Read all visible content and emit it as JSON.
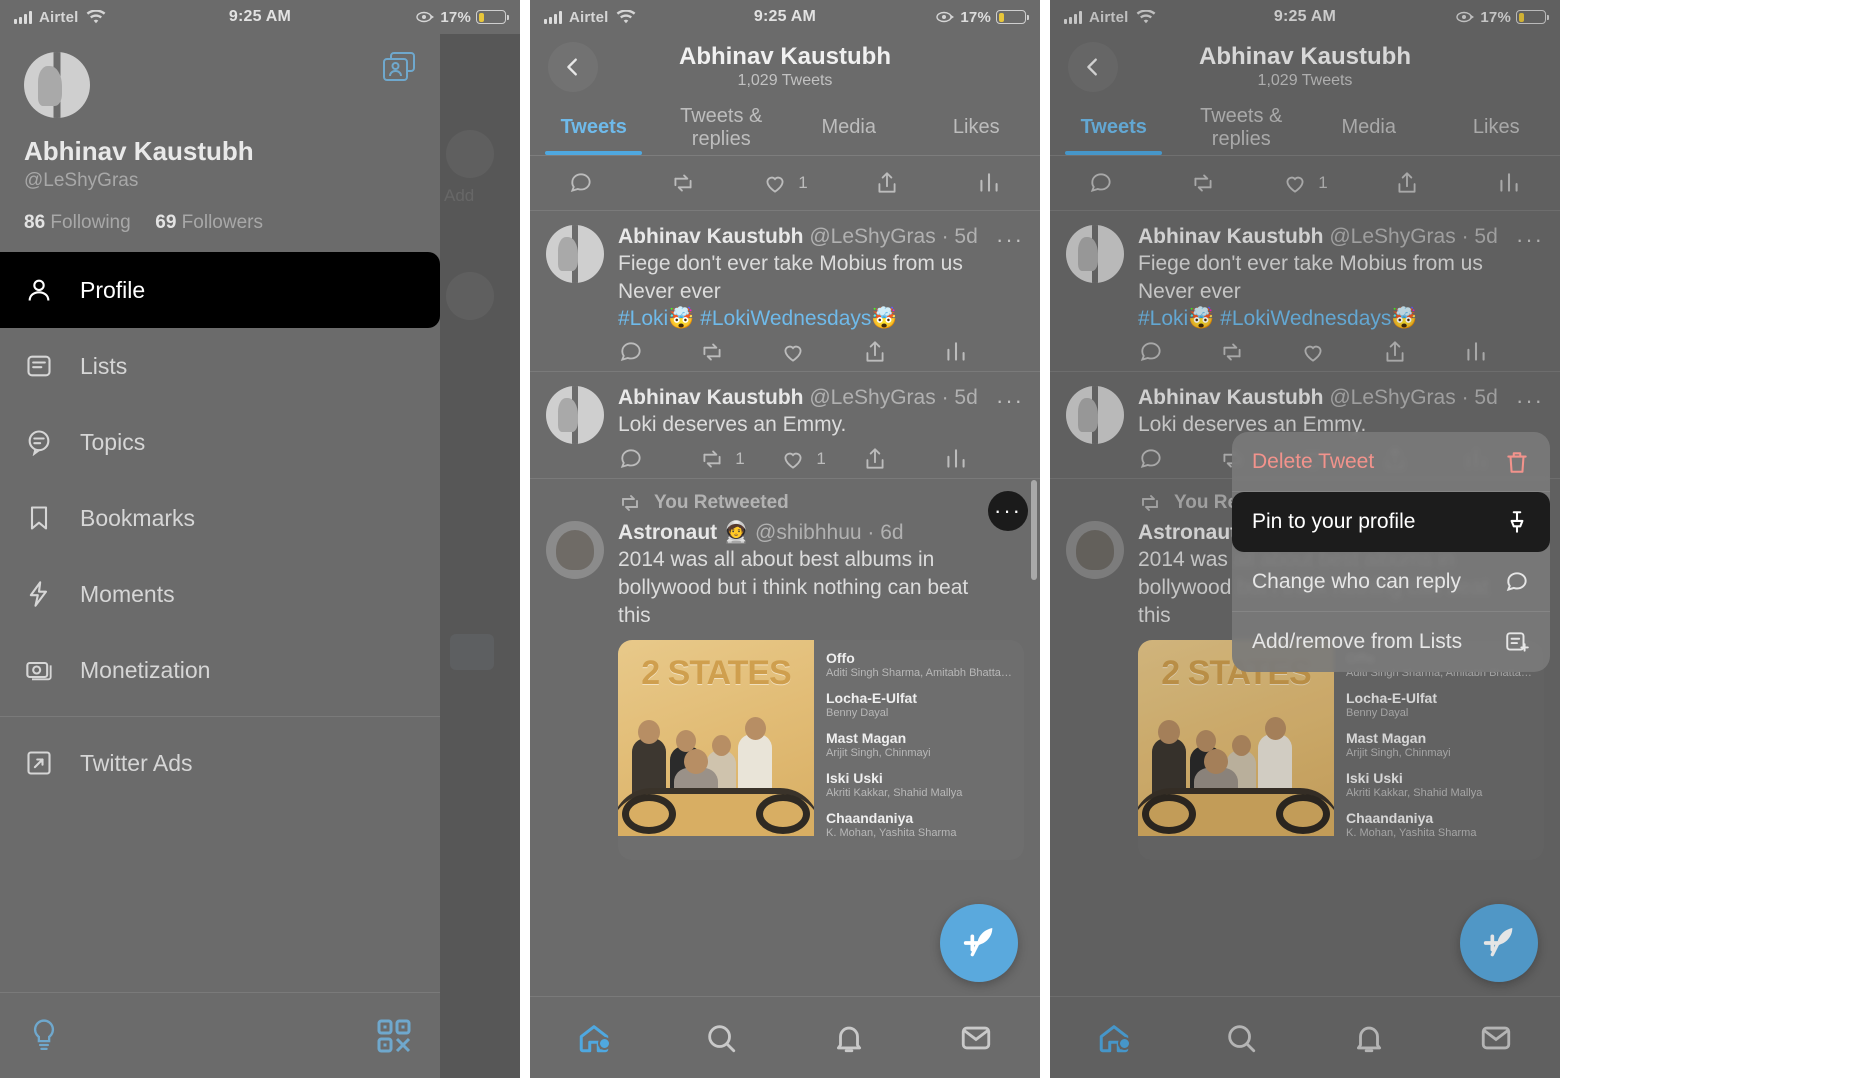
{
  "status_bar": {
    "carrier": "Airtel",
    "time": "9:25 AM",
    "battery_pct": "17%",
    "signal_icon": "cellular-bars-icon",
    "wifi_icon": "wifi-icon",
    "rotation_lock_icon": "rotation-lock-icon",
    "battery_icon": "battery-icon"
  },
  "colors": {
    "accent_blue": "#4fa8e0",
    "link_blue": "#6fbaea",
    "danger_red": "#f2938c",
    "highlight_black": "#1c1c1c",
    "panel_bg": "#6b6b6b"
  },
  "panel1": {
    "profile": {
      "avatar_icon": "profile-avatar",
      "name": "Abhinav Kaustubh",
      "handle": "@LeShyGras",
      "following_count": "86",
      "following_label": "Following",
      "followers_count": "69",
      "followers_label": "Followers",
      "add_account_icon": "add-account-icon"
    },
    "menu_items": [
      {
        "label": "Profile",
        "icon": "person-icon",
        "active": true
      },
      {
        "label": "Lists",
        "icon": "lists-icon",
        "active": false
      },
      {
        "label": "Topics",
        "icon": "topics-icon",
        "active": false
      },
      {
        "label": "Bookmarks",
        "icon": "bookmark-icon",
        "active": false
      },
      {
        "label": "Moments",
        "icon": "moments-bolt-icon",
        "active": false
      },
      {
        "label": "Monetization",
        "icon": "money-icon",
        "active": false
      },
      {
        "label": "Twitter Ads",
        "icon": "external-link-icon",
        "active": false
      }
    ],
    "footer": {
      "theme_icon": "lightbulb-icon",
      "qr_icon": "qr-code-icon"
    }
  },
  "panel2": {
    "header": {
      "back_icon": "chevron-left-icon",
      "title": "Abhinav Kaustubh",
      "subtitle": "1,029 Tweets"
    },
    "tabs": [
      {
        "label": "Tweets",
        "selected": true
      },
      {
        "label": "Tweets & replies",
        "selected": false
      },
      {
        "label": "Media",
        "selected": false
      },
      {
        "label": "Likes",
        "selected": false
      }
    ],
    "top_actions": [
      {
        "icon": "reply-icon",
        "count": ""
      },
      {
        "icon": "retweet-icon",
        "count": ""
      },
      {
        "icon": "like-icon",
        "count": "1"
      },
      {
        "icon": "share-icon",
        "count": ""
      },
      {
        "icon": "analytics-icon",
        "count": ""
      }
    ],
    "tweets": [
      {
        "author": "Abhinav Kaustubh",
        "handle": "@LeShyGras",
        "separator": "·",
        "time": "5d",
        "text_lines": [
          "Fiege don't ever take Mobius from us",
          "Never ever"
        ],
        "hashtags": "#Loki🤯 #LokiWednesdays🤯",
        "more_icon": "more-dots-icon",
        "actions": [
          {
            "icon": "reply-icon",
            "count": ""
          },
          {
            "icon": "retweet-icon",
            "count": ""
          },
          {
            "icon": "like-icon",
            "count": ""
          },
          {
            "icon": "share-icon",
            "count": ""
          },
          {
            "icon": "analytics-icon",
            "count": ""
          }
        ]
      },
      {
        "author": "Abhinav Kaustubh",
        "handle": "@LeShyGras",
        "separator": "·",
        "time": "5d",
        "text_lines": [
          "Loki deserves an Emmy."
        ],
        "hashtags": "",
        "more_icon": "more-dots-icon",
        "actions": [
          {
            "icon": "reply-icon",
            "count": ""
          },
          {
            "icon": "retweet-icon",
            "count": "1"
          },
          {
            "icon": "like-icon",
            "count": "1"
          },
          {
            "icon": "share-icon",
            "count": ""
          },
          {
            "icon": "analytics-icon",
            "count": ""
          }
        ]
      }
    ],
    "retweet": {
      "context_icon": "retweet-icon",
      "context_label": "You Retweeted",
      "author": "Astronaut 🧑‍🚀",
      "handle": "@shibhhuu",
      "separator": "·",
      "time": "6d",
      "text_lines": [
        "2014 was all about best albums in",
        "bollywood but i think nothing can beat",
        "this"
      ],
      "more_icon": "more-dots-icon",
      "card": {
        "album_title": "2 STATES",
        "tracks": [
          {
            "name": "Offo",
            "artists": "Aditi Singh Sharma, Amitabh Bhattacharya"
          },
          {
            "name": "Locha-E-Ulfat",
            "artists": "Benny Dayal"
          },
          {
            "name": "Mast Magan",
            "artists": "Arijit Singh, Chinmayi"
          },
          {
            "name": "Iski Uski",
            "artists": "Akriti Kakkar, Shahid Mallya"
          },
          {
            "name": "Chaandaniya",
            "artists": "K. Mohan, Yashita Sharma"
          }
        ]
      }
    },
    "compose_fab": {
      "icon": "compose-feather-icon"
    },
    "tabbar": [
      {
        "icon": "home-icon",
        "selected": true,
        "badge": true
      },
      {
        "icon": "search-icon",
        "selected": false,
        "badge": false
      },
      {
        "icon": "notifications-bell-icon",
        "selected": false,
        "badge": false
      },
      {
        "icon": "messages-envelope-icon",
        "selected": false,
        "badge": false
      }
    ]
  },
  "panel3": {
    "context_menu": [
      {
        "label": "Delete Tweet",
        "icon": "trash-icon",
        "style": "danger",
        "highlighted": false
      },
      {
        "label": "Pin to your profile",
        "icon": "pin-icon",
        "style": "normal",
        "highlighted": true
      },
      {
        "label": "Change who can reply",
        "icon": "reply-bubble-icon",
        "style": "normal",
        "highlighted": false
      },
      {
        "label": "Add/remove from Lists",
        "icon": "add-to-list-icon",
        "style": "normal",
        "highlighted": false
      }
    ]
  }
}
